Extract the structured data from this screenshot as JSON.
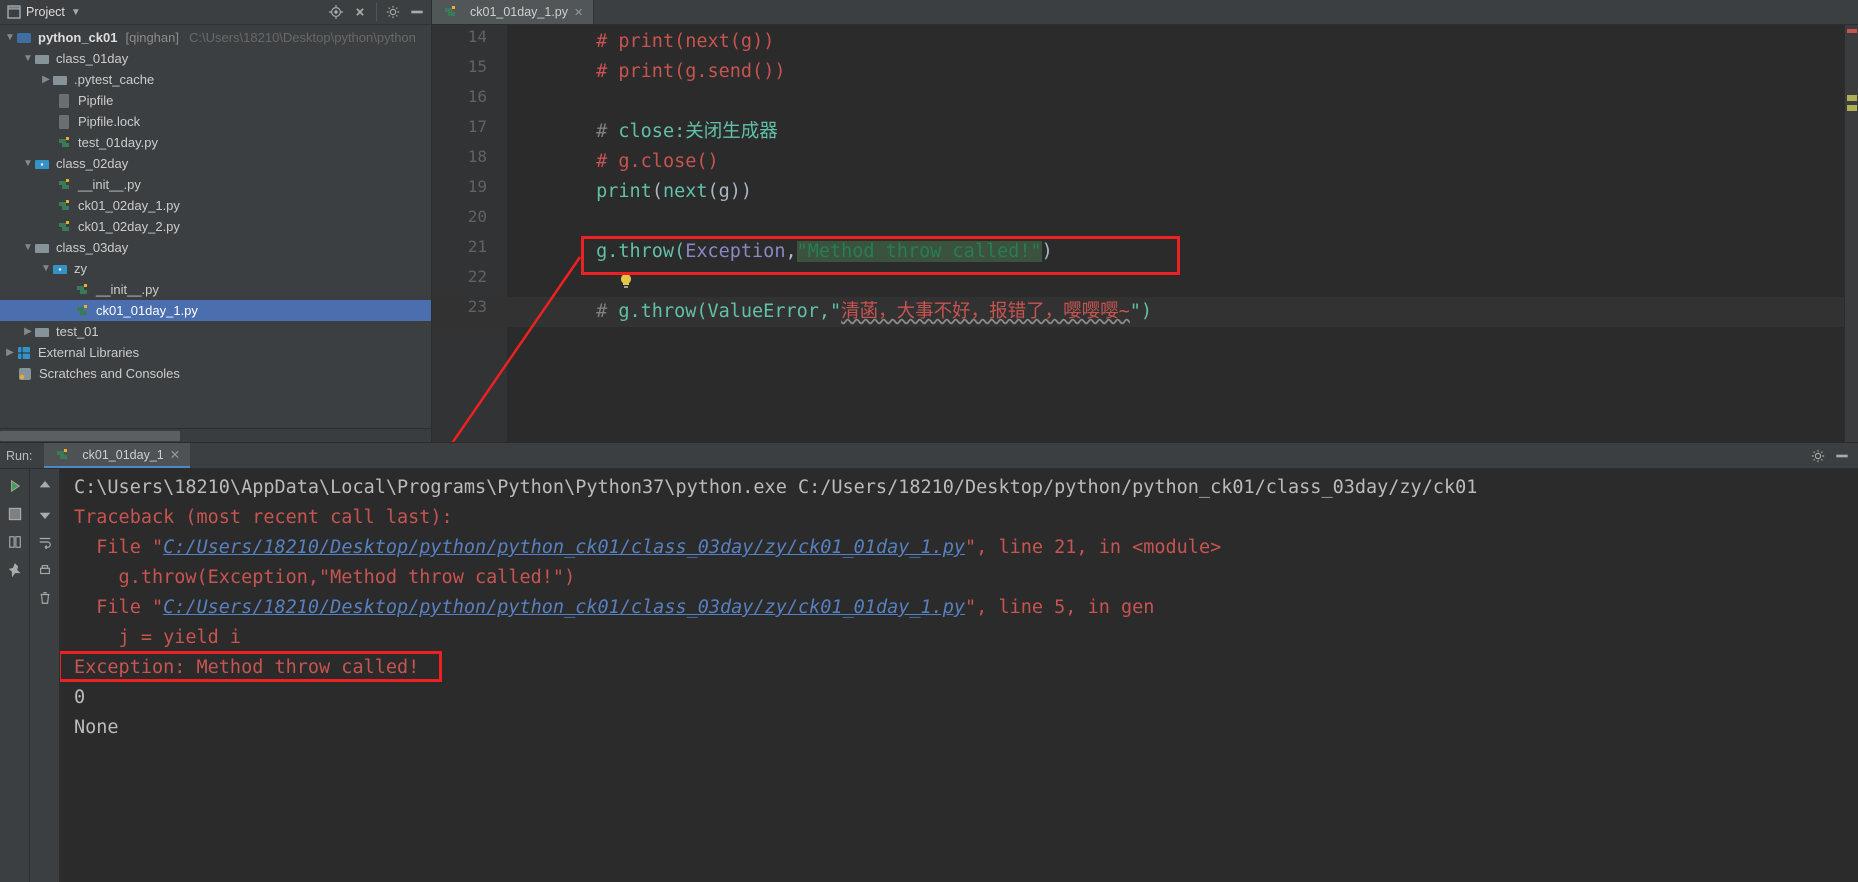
{
  "sidebar": {
    "title": "Project",
    "project_name": "python_ck01",
    "project_branch": "[qinghan]",
    "project_path": "C:\\Users\\18210\\Desktop\\python\\python",
    "tree": {
      "class01": "class_01day",
      "pytest_cache": ".pytest_cache",
      "pipfile": "Pipfile",
      "pipfile_lock": "Pipfile.lock",
      "test_01day": "test_01day.py",
      "class02": "class_02day",
      "init02": "__init__.py",
      "ck02_1": "ck01_02day_1.py",
      "ck02_2": "ck01_02day_2.py",
      "class03": "class_03day",
      "zy": "zy",
      "init_zy": "__init__.py",
      "ck01": "ck01_01day_1.py",
      "test01": "test_01",
      "ext_lib": "External Libraries",
      "scratch": "Scratches and Consoles"
    }
  },
  "editor": {
    "tab_name": "ck01_01day_1.py",
    "lines": {
      "n14": "14",
      "n15": "15",
      "n16": "16",
      "n17": "17",
      "n18": "18",
      "n19": "19",
      "n20": "20",
      "n21": "21",
      "n22": "22",
      "n23": "23"
    },
    "code": {
      "l14a": "# ",
      "l14b": "print",
      "l14c": "(",
      "l14d": "next",
      "l14e": "(g))",
      "l15a": "# ",
      "l15b": "print",
      "l15c": "(g.send())",
      "l16": "",
      "l17a": "# ",
      "l17b": "close:关闭生成器",
      "l18a": "# ",
      "l18b": "g.close()",
      "l19a": "print",
      "l19b": "(",
      "l19c": "next",
      "l19d": "(g))",
      "l21a": "g.throw(",
      "l21b": "Exception",
      "l21c": ",",
      "l21d": "\"Method throw called!\"",
      "l21e": ")",
      "l23a": "# ",
      "l23b": "g.throw(ValueError,\"",
      "l23c": "清菡，大事不好，报错了，嘤嘤嘤~",
      "l23d": "\")"
    }
  },
  "run": {
    "title": "Run:",
    "tab": "ck01_01day_1",
    "console": {
      "c1": "C:\\Users\\18210\\AppData\\Local\\Programs\\Python\\Python37\\python.exe C:/Users/18210/Desktop/python/python_ck01/class_03day/zy/ck01",
      "c2": "Traceback (most recent call last):",
      "c3a": "  File \"",
      "c3b": "C:/Users/18210/Desktop/python/python_ck01/class_03day/zy/ck01_01day_1.py",
      "c3c": "\", line 21, in <module>",
      "c4": "    g.throw(Exception,\"Method throw called!\")",
      "c5a": "  File \"",
      "c5b": "C:/Users/18210/Desktop/python/python_ck01/class_03day/zy/ck01_01day_1.py",
      "c5c": "\", line 5, in gen",
      "c6": "    j = yield i",
      "c7": "Exception: Method throw called!",
      "c8": "0",
      "c9": "None"
    }
  }
}
